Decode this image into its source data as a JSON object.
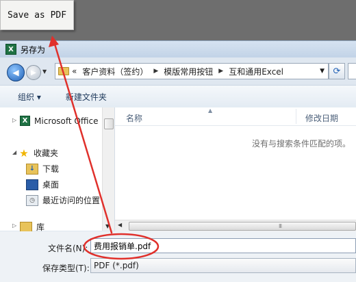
{
  "tooltip": {
    "text": "Save as PDF"
  },
  "window": {
    "title": "另存为"
  },
  "address": {
    "prefix": "«",
    "crumbs": [
      "客户资料（签约）",
      "模版常用按钮",
      "互和通用Excel"
    ]
  },
  "toolbar": {
    "organize": "组织 ▾",
    "new_folder": "新建文件夹"
  },
  "sidebar": {
    "items": [
      {
        "label": "Microsoft Office",
        "icon": "excel-icon"
      },
      {
        "label": "收藏夹",
        "icon": "star-icon"
      },
      {
        "label": "下载",
        "icon": "download-folder-icon"
      },
      {
        "label": "桌面",
        "icon": "desktop-icon"
      },
      {
        "label": "最近访问的位置",
        "icon": "recent-places-icon"
      },
      {
        "label": "库",
        "icon": "library-icon"
      }
    ]
  },
  "filelist": {
    "col_name": "名称",
    "col_date": "修改日期",
    "empty_message": "没有与搜索条件匹配的项。"
  },
  "form": {
    "filename_label": "文件名(N):",
    "filename_value": "费用报销单.pdf",
    "filetype_label": "保存类型(T):",
    "filetype_value": "PDF (*.pdf)"
  },
  "annotation_color": "#e0302b"
}
